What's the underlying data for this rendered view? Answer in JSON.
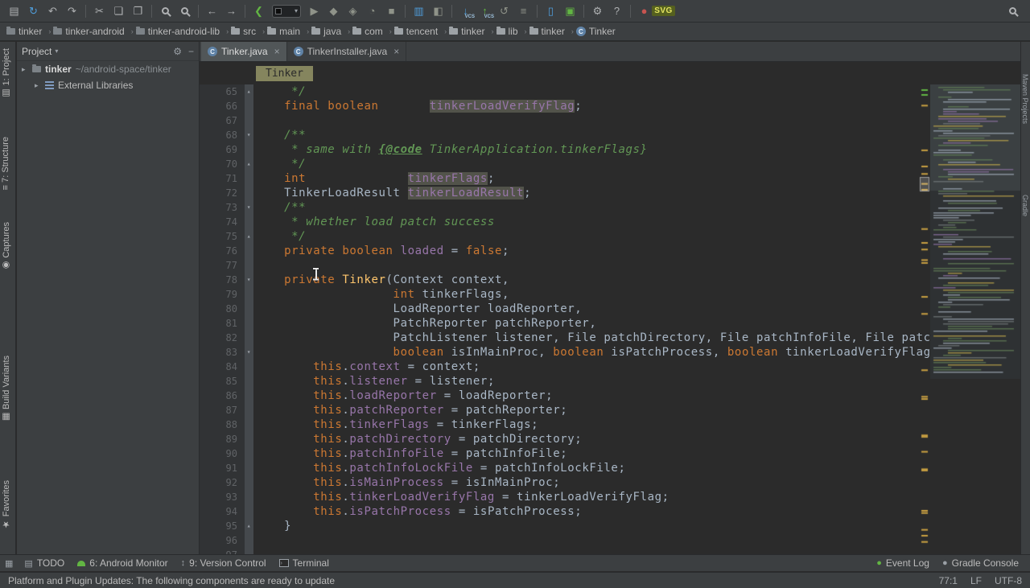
{
  "toolbar": {
    "icons": [
      {
        "name": "open-project",
        "glyph": "▤",
        "color": "#afb1b3"
      },
      {
        "name": "sync-project",
        "glyph": "↻",
        "color": "#4f9ddb"
      },
      {
        "name": "undo",
        "glyph": "↶",
        "color": "#afb1b3"
      },
      {
        "name": "redo",
        "glyph": "↷",
        "color": "#afb1b3"
      },
      {
        "sep": true
      },
      {
        "name": "cut",
        "glyph": "✂",
        "color": "#afb1b3"
      },
      {
        "name": "copy",
        "glyph": "❏",
        "color": "#afb1b3"
      },
      {
        "name": "paste",
        "glyph": "❐",
        "color": "#afb1b3"
      },
      {
        "sep": true
      },
      {
        "name": "find",
        "type": "mag"
      },
      {
        "name": "find-in-path",
        "type": "mag"
      },
      {
        "sep": true
      },
      {
        "name": "navigate-back",
        "glyph": "←",
        "color": "#afb1b3"
      },
      {
        "name": "navigate-forward",
        "glyph": "→",
        "color": "#afb1b3"
      },
      {
        "sep": true
      },
      {
        "name": "make-project",
        "glyph": "❮",
        "color": "#62b543"
      },
      {
        "name": "run-configurations",
        "type": "select"
      },
      {
        "name": "run",
        "glyph": "▶",
        "color": "#8f9389"
      },
      {
        "name": "debug",
        "glyph": "◆",
        "color": "#8f9389"
      },
      {
        "name": "run-with-coverage",
        "glyph": "◈",
        "color": "#8f9389"
      },
      {
        "name": "profile",
        "glyph": "◔",
        "color": "#8f9389"
      },
      {
        "name": "stop",
        "glyph": "■",
        "color": "#8f9389"
      },
      {
        "sep": true
      },
      {
        "name": "android-monitor",
        "glyph": "▥",
        "color": "#4f9ddb"
      },
      {
        "name": "screen-capture",
        "glyph": "◧",
        "color": "#8f9389"
      },
      {
        "sep": true
      },
      {
        "name": "vcs-update",
        "glyph": "↓",
        "color": "#4f9ddb",
        "badge": "VCS"
      },
      {
        "name": "vcs-commit",
        "glyph": "↑",
        "color": "#62b543",
        "badge": "VCS"
      },
      {
        "name": "vcs-revert",
        "glyph": "↺",
        "color": "#8f9389"
      },
      {
        "name": "vcs-history",
        "glyph": "≡",
        "color": "#8f9389"
      },
      {
        "sep": true
      },
      {
        "name": "avd-manager",
        "glyph": "▯",
        "color": "#4f9ddb"
      },
      {
        "name": "sdk-manager",
        "glyph": "▣",
        "color": "#62b543"
      },
      {
        "sep": true
      },
      {
        "name": "settings",
        "glyph": "⚙",
        "color": "#afb1b3"
      },
      {
        "name": "help",
        "glyph": "?",
        "color": "#afb1b3"
      },
      {
        "sep": true
      },
      {
        "name": "record-screen",
        "glyph": "●",
        "color": "#c75450"
      },
      {
        "name": "svg-plugin",
        "type": "chip",
        "label": "SVG"
      }
    ],
    "right_icon": {
      "name": "search-everywhere",
      "type": "mag"
    }
  },
  "path_bar": {
    "items": [
      {
        "label": "tinker",
        "icon": "folder-dark"
      },
      {
        "label": "tinker-android",
        "icon": "folder-dark"
      },
      {
        "label": "tinker-android-lib",
        "icon": "folder-dark"
      },
      {
        "label": "src",
        "icon": "folder"
      },
      {
        "label": "main",
        "icon": "folder"
      },
      {
        "label": "java",
        "icon": "folder"
      },
      {
        "label": "com",
        "icon": "folder"
      },
      {
        "label": "tencent",
        "icon": "folder"
      },
      {
        "label": "tinker",
        "icon": "folder"
      },
      {
        "label": "lib",
        "icon": "folder"
      },
      {
        "label": "tinker",
        "icon": "folder"
      },
      {
        "label": "Tinker",
        "icon": "class"
      }
    ]
  },
  "left_strip": {
    "items": [
      {
        "label": "1: Project",
        "icon": "▤"
      },
      {
        "label": "7: Structure",
        "icon": "≡"
      },
      {
        "label": "Captures",
        "icon": "◉"
      },
      {
        "label": "Build Variants",
        "icon": "▦"
      },
      {
        "label": "Favorites",
        "icon": "★"
      }
    ]
  },
  "right_strip": {
    "items": [
      {
        "label": "Maven Projects"
      },
      {
        "label": "Gradle"
      }
    ]
  },
  "project_panel": {
    "title": "Project",
    "root_label": "tinker",
    "root_path": " ~/android-space/tinker",
    "lib_label": "External Libraries"
  },
  "editor": {
    "tabs": [
      {
        "label": "Tinker.java",
        "icon": "C",
        "active": true,
        "close": "×"
      },
      {
        "label": "TinkerInstaller.java",
        "icon": "C",
        "active": false,
        "close": "×"
      }
    ],
    "crumb": "Tinker",
    "code": [
      {
        "n": 65,
        "f": "up",
        "s": [
          [
            "d",
            "     "
          ],
          [
            "c",
            "*/"
          ]
        ]
      },
      {
        "n": 66,
        "f": "",
        "s": [
          [
            "d",
            "    "
          ],
          [
            "k",
            "final boolean"
          ],
          [
            "d",
            "       "
          ],
          [
            "hl",
            "tinkerLoadVerifyFlag"
          ],
          [
            "d",
            ";"
          ]
        ]
      },
      {
        "n": 67,
        "f": "",
        "s": []
      },
      {
        "n": 68,
        "f": "dn",
        "s": [
          [
            "d",
            "    "
          ],
          [
            "c",
            "/**"
          ]
        ]
      },
      {
        "n": 69,
        "f": "",
        "s": [
          [
            "d",
            "     "
          ],
          [
            "c",
            "* same with "
          ],
          [
            "ct",
            "{@code"
          ],
          [
            "c",
            " TinkerApplication.tinkerFlags}"
          ]
        ]
      },
      {
        "n": 70,
        "f": "up",
        "s": [
          [
            "d",
            "     "
          ],
          [
            "c",
            "*/"
          ]
        ]
      },
      {
        "n": 71,
        "f": "",
        "s": [
          [
            "d",
            "    "
          ],
          [
            "k",
            "int"
          ],
          [
            "d",
            "              "
          ],
          [
            "hl",
            "tinkerFlags"
          ],
          [
            "d",
            ";"
          ]
        ]
      },
      {
        "n": 72,
        "f": "",
        "s": [
          [
            "d",
            "    TinkerLoadResult "
          ],
          [
            "hl",
            "tinkerLoadResult"
          ],
          [
            "d",
            ";"
          ]
        ]
      },
      {
        "n": 73,
        "f": "dn",
        "s": [
          [
            "d",
            "    "
          ],
          [
            "c",
            "/**"
          ]
        ]
      },
      {
        "n": 74,
        "f": "",
        "s": [
          [
            "d",
            "     "
          ],
          [
            "c",
            "* whether load patch success"
          ]
        ]
      },
      {
        "n": 75,
        "f": "up",
        "s": [
          [
            "d",
            "     "
          ],
          [
            "c",
            "*/"
          ]
        ]
      },
      {
        "n": 76,
        "f": "",
        "s": [
          [
            "d",
            "    "
          ],
          [
            "k",
            "private boolean"
          ],
          [
            "d",
            " "
          ],
          [
            "f",
            "loaded"
          ],
          [
            "d",
            " = "
          ],
          [
            "k",
            "false"
          ],
          [
            "d",
            ";"
          ]
        ]
      },
      {
        "n": 77,
        "f": "",
        "s": []
      },
      {
        "n": 78,
        "f": "dn",
        "s": [
          [
            "d",
            "    "
          ],
          [
            "k",
            "private"
          ],
          [
            "d",
            " "
          ],
          [
            "m",
            "Tinker"
          ],
          [
            "d",
            "(Context context,"
          ]
        ]
      },
      {
        "n": 79,
        "f": "",
        "s": [
          [
            "d",
            "                   "
          ],
          [
            "k",
            "int"
          ],
          [
            "d",
            " tinkerFlags,"
          ]
        ]
      },
      {
        "n": 80,
        "f": "",
        "s": [
          [
            "d",
            "                   LoadReporter loadReporter,"
          ]
        ]
      },
      {
        "n": 81,
        "f": "",
        "s": [
          [
            "d",
            "                   PatchReporter patchReporter,"
          ]
        ]
      },
      {
        "n": 82,
        "f": "",
        "s": [
          [
            "d",
            "                   PatchListener listener, File patchDirectory, File patchInfoFile, File patchInfoLockFile,"
          ]
        ]
      },
      {
        "n": 83,
        "f": "dn",
        "s": [
          [
            "d",
            "                   "
          ],
          [
            "k",
            "boolean"
          ],
          [
            "d",
            " isInMainProc, "
          ],
          [
            "k",
            "boolean"
          ],
          [
            "d",
            " isPatchProcess, "
          ],
          [
            "k",
            "boolean"
          ],
          [
            "d",
            " tinkerLoadVerifyFlag) {"
          ]
        ]
      },
      {
        "n": 84,
        "f": "",
        "s": [
          [
            "d",
            "        "
          ],
          [
            "k",
            "this"
          ],
          [
            "d",
            "."
          ],
          [
            "f",
            "context"
          ],
          [
            "d",
            " = context;"
          ]
        ]
      },
      {
        "n": 85,
        "f": "",
        "s": [
          [
            "d",
            "        "
          ],
          [
            "k",
            "this"
          ],
          [
            "d",
            "."
          ],
          [
            "f",
            "listener"
          ],
          [
            "d",
            " = listener;"
          ]
        ]
      },
      {
        "n": 86,
        "f": "",
        "s": [
          [
            "d",
            "        "
          ],
          [
            "k",
            "this"
          ],
          [
            "d",
            "."
          ],
          [
            "f",
            "loadReporter"
          ],
          [
            "d",
            " = loadReporter;"
          ]
        ]
      },
      {
        "n": 87,
        "f": "",
        "s": [
          [
            "d",
            "        "
          ],
          [
            "k",
            "this"
          ],
          [
            "d",
            "."
          ],
          [
            "f",
            "patchReporter"
          ],
          [
            "d",
            " = patchReporter;"
          ]
        ]
      },
      {
        "n": 88,
        "f": "",
        "s": [
          [
            "d",
            "        "
          ],
          [
            "k",
            "this"
          ],
          [
            "d",
            "."
          ],
          [
            "f",
            "tinkerFlags"
          ],
          [
            "d",
            " = tinkerFlags;"
          ]
        ]
      },
      {
        "n": 89,
        "f": "",
        "s": [
          [
            "d",
            "        "
          ],
          [
            "k",
            "this"
          ],
          [
            "d",
            "."
          ],
          [
            "f",
            "patchDirectory"
          ],
          [
            "d",
            " = patchDirectory;"
          ]
        ]
      },
      {
        "n": 90,
        "f": "",
        "s": [
          [
            "d",
            "        "
          ],
          [
            "k",
            "this"
          ],
          [
            "d",
            "."
          ],
          [
            "f",
            "patchInfoFile"
          ],
          [
            "d",
            " = patchInfoFile;"
          ]
        ]
      },
      {
        "n": 91,
        "f": "",
        "s": [
          [
            "d",
            "        "
          ],
          [
            "k",
            "this"
          ],
          [
            "d",
            "."
          ],
          [
            "f",
            "patchInfoLockFile"
          ],
          [
            "d",
            " = patchInfoLockFile;"
          ]
        ]
      },
      {
        "n": 92,
        "f": "",
        "s": [
          [
            "d",
            "        "
          ],
          [
            "k",
            "this"
          ],
          [
            "d",
            "."
          ],
          [
            "f",
            "isMainProcess"
          ],
          [
            "d",
            " = isInMainProc;"
          ]
        ]
      },
      {
        "n": 93,
        "f": "",
        "s": [
          [
            "d",
            "        "
          ],
          [
            "k",
            "this"
          ],
          [
            "d",
            "."
          ],
          [
            "f",
            "tinkerLoadVerifyFlag"
          ],
          [
            "d",
            " = tinkerLoadVerifyFlag;"
          ]
        ]
      },
      {
        "n": 94,
        "f": "",
        "s": [
          [
            "d",
            "        "
          ],
          [
            "k",
            "this"
          ],
          [
            "d",
            "."
          ],
          [
            "f",
            "isPatchProcess"
          ],
          [
            "d",
            " = isPatchProcess;"
          ]
        ]
      },
      {
        "n": 95,
        "f": "up",
        "s": [
          [
            "d",
            "    }"
          ]
        ]
      },
      {
        "n": 96,
        "f": "",
        "s": []
      },
      {
        "n": 97,
        "f": "",
        "s": []
      }
    ]
  },
  "bottom_bar": {
    "toggle_icon": "▦",
    "left": [
      {
        "label": "TODO",
        "icon": "todo"
      },
      {
        "label": "6: Android Monitor",
        "icon": "android"
      },
      {
        "label": "9: Version Control",
        "icon": "vcs"
      },
      {
        "label": "Terminal",
        "icon": "terminal"
      }
    ],
    "right": [
      {
        "label": "Event Log",
        "icon": "event"
      },
      {
        "label": "Gradle Console",
        "icon": "gradle"
      }
    ]
  },
  "status_bar": {
    "message": "Platform and Plugin Updates: The following components are ready to update",
    "right": [
      "77:1",
      "LF",
      "UTF-8"
    ]
  },
  "colors": {
    "accent_blue": "#4f9ddb",
    "accent_green": "#62b543",
    "accent_red": "#c75450",
    "keyword": "#cc7832",
    "field": "#9876aa",
    "comment": "#629755",
    "method": "#ffc66d"
  }
}
